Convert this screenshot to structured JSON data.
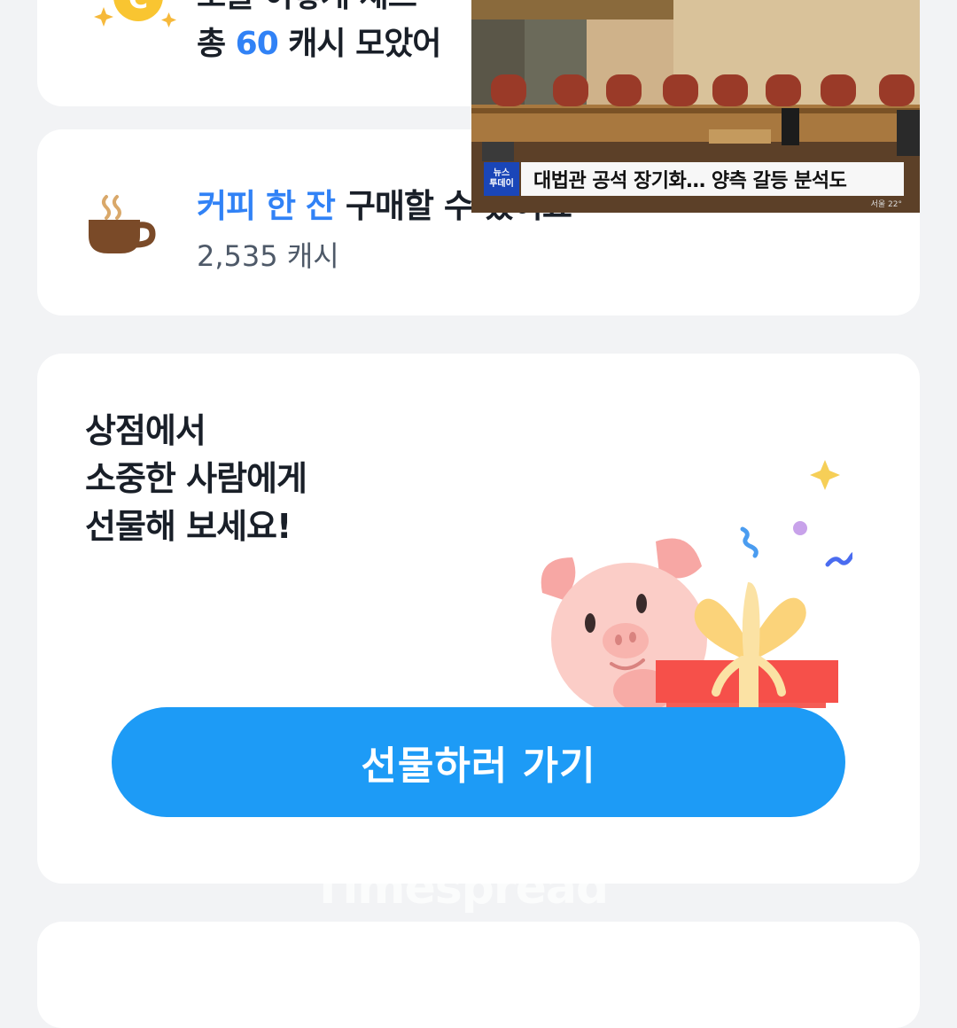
{
  "summary_card": {
    "line1": "오늘 이렇게 제스",
    "line2_prefix": "총 ",
    "line2_amount": "60",
    "line2_suffix": " 캐시 모았어",
    "coin_letter": "C",
    "icon": "coin-icon"
  },
  "coffee_card": {
    "title_highlight": "커피 한 잔",
    "title_rest": " 구매할 수 있어요",
    "cash": "2,535 캐시",
    "icon": "coffee-cup-icon"
  },
  "gift_card": {
    "lines": [
      "상점에서",
      "소중한 사람에게",
      "선물해 보세요!"
    ],
    "button_label": "선물하러 가기",
    "illustration": "pig-with-gift-illustration"
  },
  "video_overlay": {
    "channel_logo": [
      "뉴스",
      "투데이"
    ],
    "caption": "대법관 공석 장기화… 양측 갈등 분석도",
    "meta": "서울 22°"
  },
  "watermark": "Timespread",
  "colors": {
    "accent_blue": "#3182f6",
    "button_blue": "#1d9bf6",
    "background": "#f2f3f5"
  }
}
